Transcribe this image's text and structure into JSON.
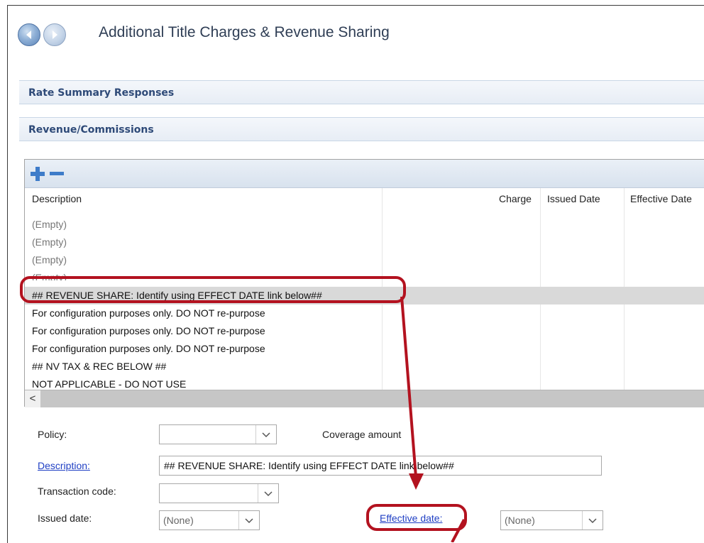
{
  "header": {
    "title": "Additional Title Charges & Revenue Sharing"
  },
  "sections": [
    {
      "label": "Rate Summary Responses"
    },
    {
      "label": "Revenue/Commissions"
    }
  ],
  "grid": {
    "toolbar": {
      "add_icon": "plus-icon",
      "remove_icon": "minus-icon"
    },
    "columns": {
      "description": "Description",
      "charge": "Charge",
      "issued_date": "Issued Date",
      "effective_date": "Effective Date"
    },
    "rows": [
      {
        "description": "(Empty)"
      },
      {
        "description": "(Empty)"
      },
      {
        "description": "(Empty)"
      },
      {
        "description": "(Empty)"
      },
      {
        "description": "## REVENUE SHARE: Identify using EFFECT DATE link below##"
      },
      {
        "description": "For configuration purposes only. DO NOT re-purpose"
      },
      {
        "description": "For configuration purposes only. DO NOT re-purpose"
      },
      {
        "description": "For configuration purposes only. DO NOT re-purpose"
      },
      {
        "description": "## NV TAX & REC BELOW ##"
      },
      {
        "description": "NOT APPLICABLE - DO NOT USE"
      }
    ],
    "scroll_left": "<"
  },
  "form": {
    "policy_label": "Policy:",
    "policy_value": "",
    "coverage_label": "Coverage amount",
    "description_link": "Description:",
    "description_value": "## REVENUE SHARE: Identify using EFFECT DATE link below##",
    "transaction_label": "Transaction code:",
    "transaction_value": "",
    "issued_label": "Issued date:",
    "issued_value": "(None)",
    "effective_link": "Effective date:",
    "effective_value": "(None)"
  },
  "colors": {
    "annotation": "#b3121f",
    "link": "#1f3fc4",
    "section_text": "#2e4a78"
  }
}
